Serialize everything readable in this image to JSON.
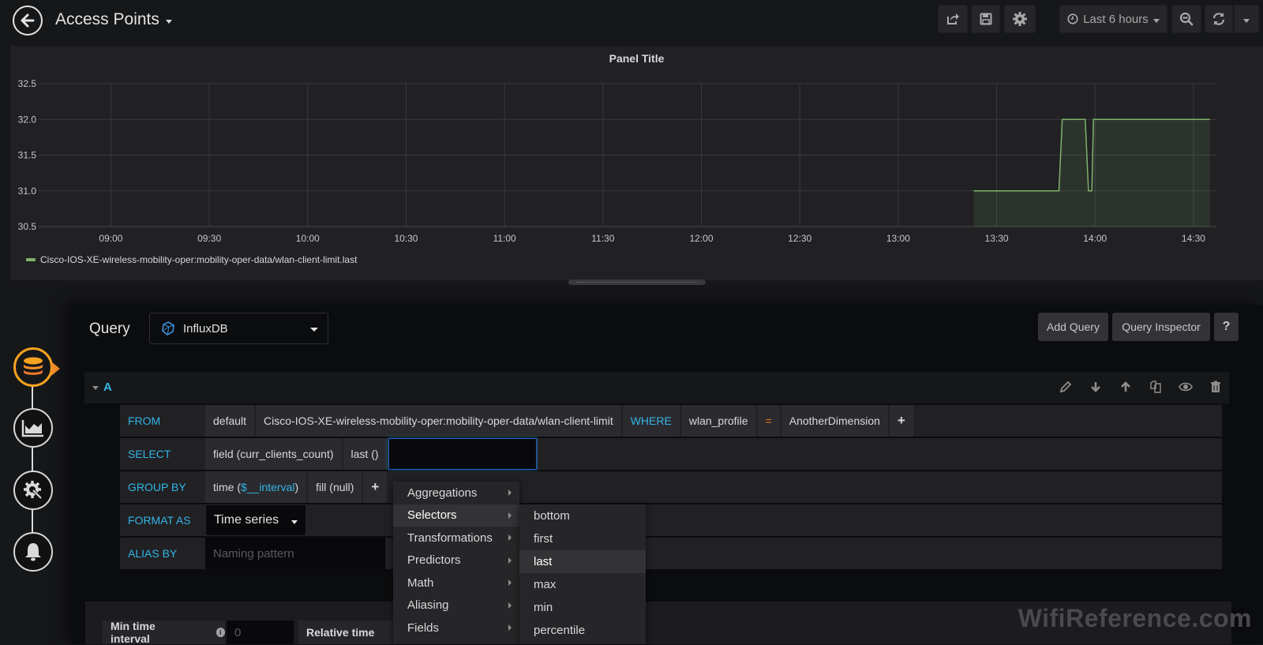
{
  "topbar": {
    "title": "Access Points",
    "time_range": "Last 6 hours",
    "buttons": [
      "share",
      "save",
      "settings",
      "zoom-out",
      "refresh",
      "refresh-interval"
    ]
  },
  "panel": {
    "title": "Panel Title"
  },
  "chart_data": {
    "type": "line",
    "title": "Panel Title",
    "xlabel": "",
    "ylabel": "",
    "ylim": [
      30.5,
      32.5
    ],
    "xlim": [
      "08:38",
      "14:37"
    ],
    "y_ticks": [
      "30.5",
      "31.0",
      "31.5",
      "32.0",
      "32.5"
    ],
    "x_ticks": [
      "09:00",
      "09:30",
      "10:00",
      "10:30",
      "11:00",
      "11:30",
      "12:00",
      "12:30",
      "13:00",
      "13:30",
      "14:00",
      "14:30"
    ],
    "grid": true,
    "legend_position": "bottom-left",
    "fill": true,
    "series": [
      {
        "name": "Cisco-IOS-XE-wireless-mobility-oper:mobility-oper-data/wlan-client-limit.last",
        "color": "#7eb26d",
        "points": [
          [
            "13:23",
            31.0
          ],
          [
            "13:49",
            31.0
          ],
          [
            "13:50",
            32.0
          ],
          [
            "13:57",
            32.0
          ],
          [
            "13:58",
            31.0
          ],
          [
            "13:59",
            31.0
          ],
          [
            "13:59.5",
            32.0
          ],
          [
            "14:35",
            32.0
          ]
        ]
      }
    ]
  },
  "query_editor": {
    "label": "Query",
    "datasource": "InfluxDB",
    "add_query": "Add Query",
    "query_inspector": "Query Inspector",
    "help": "?",
    "query": {
      "ref_id": "A",
      "from": {
        "keyword": "FROM",
        "policy": "default",
        "measurement": "Cisco-IOS-XE-wireless-mobility-oper:mobility-oper-data/wlan-client-limit",
        "where_keyword": "WHERE",
        "tag": "wlan_profile",
        "operator": "=",
        "value": "AnotherDimension",
        "add": "+"
      },
      "select": {
        "keyword": "SELECT",
        "field": "field (curr_clients_count)",
        "func": "last ()",
        "input_value": ""
      },
      "group_by": {
        "keyword": "GROUP BY",
        "time_prefix": "time (",
        "time_var": "$__interval",
        "time_suffix": ")",
        "fill": "fill (null)",
        "add": "+"
      },
      "format_as": {
        "keyword": "FORMAT AS",
        "value": "Time series"
      },
      "alias_by": {
        "keyword": "ALIAS BY",
        "placeholder": "Naming pattern"
      }
    },
    "menu": {
      "items": [
        "Aggregations",
        "Selectors",
        "Transformations",
        "Predictors",
        "Math",
        "Aliasing",
        "Fields"
      ],
      "active": "Selectors",
      "submenu": [
        "bottom",
        "first",
        "last",
        "max",
        "min",
        "percentile"
      ],
      "submenu_active": "last"
    },
    "options": {
      "min_time_interval_label": "Min time interval",
      "min_time_interval_placeholder": "0",
      "relative_time_label": "Relative time"
    }
  },
  "watermark": "WifiReference.com"
}
